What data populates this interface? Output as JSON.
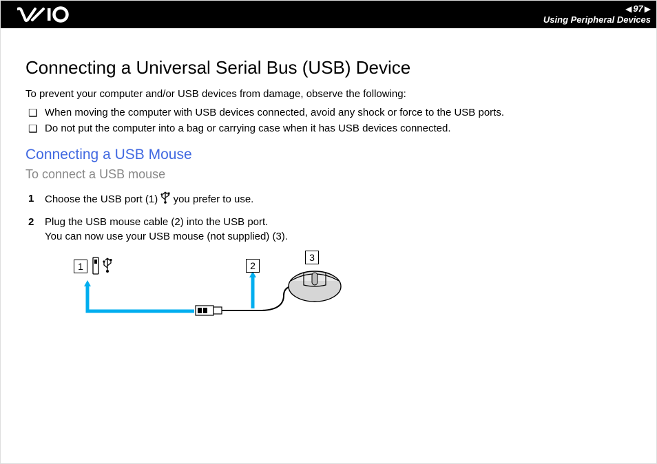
{
  "header": {
    "page_number": "97",
    "section": "Using Peripheral Devices"
  },
  "title": "Connecting a Universal Serial Bus (USB) Device",
  "intro": "To prevent your computer and/or USB devices from damage, observe the following:",
  "bullets": [
    "When moving the computer with USB devices connected, avoid any shock or force to the USB ports.",
    "Do not put the computer into a bag or carrying case when it has USB devices connected."
  ],
  "subheading": "Connecting a USB Mouse",
  "procedure_title": "To connect a USB mouse",
  "steps": {
    "s1a": "Choose the USB port (1) ",
    "s1b": " you prefer to use.",
    "s2": "Plug the USB mouse cable (2) into the USB port.\nYou can now use your USB mouse (not supplied) (3)."
  },
  "callouts": {
    "c1": "1",
    "c2": "2",
    "c3": "3"
  }
}
